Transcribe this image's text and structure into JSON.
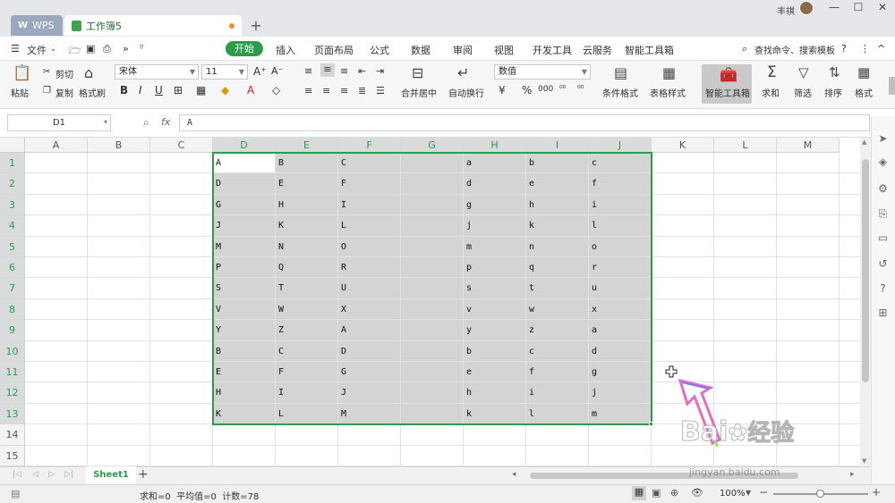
{
  "titlebar": {
    "tabs": [
      {
        "label": "WPS"
      },
      {
        "label": "工作簿5"
      }
    ],
    "add_tab": "+",
    "user_name": "丰祺",
    "window_controls": [
      "minimize-icon",
      "maximize-icon",
      "close-icon"
    ]
  },
  "menu": {
    "file": "文件",
    "start": "开始",
    "items": [
      "插入",
      "页面布局",
      "公式",
      "数据",
      "审阅",
      "视图",
      "开发工具",
      "云服务",
      "智能工具箱"
    ],
    "search": "查找命令、搜索模板"
  },
  "ribbon": {
    "paste": "粘贴",
    "cut": "剪切",
    "copy": "复制",
    "format_painter": "格式刷",
    "font_name": "宋体",
    "font_size": "11",
    "merge_center": "合并居中",
    "wrap_text": "自动换行",
    "number_format": "数值",
    "conditional_format": "条件格式",
    "table_style": "表格样式",
    "smart_toolbox": "智能工具箱",
    "sum": "求和",
    "filter": "筛选",
    "sort": "排序",
    "format": "格式",
    "percent": "%",
    "thousands": "000"
  },
  "formula_bar": {
    "name_box": "D1",
    "fx": "fx",
    "content": "A"
  },
  "sheet": {
    "columns": [
      "A",
      "B",
      "C",
      "D",
      "E",
      "F",
      "G",
      "H",
      "I",
      "J",
      "K",
      "L",
      "M"
    ],
    "rows": [
      "1",
      "2",
      "3",
      "4",
      "5",
      "6",
      "7",
      "8",
      "9",
      "10",
      "11",
      "12",
      "13",
      "14",
      "15"
    ],
    "data": [
      [
        "A",
        "B",
        "C",
        "",
        "a",
        "b",
        "c"
      ],
      [
        "D",
        "E",
        "F",
        "",
        "d",
        "e",
        "f"
      ],
      [
        "G",
        "H",
        "I",
        "",
        "g",
        "h",
        "i"
      ],
      [
        "J",
        "K",
        "L",
        "",
        "j",
        "k",
        "l"
      ],
      [
        "M",
        "N",
        "O",
        "",
        "m",
        "n",
        "o"
      ],
      [
        "P",
        "Q",
        "R",
        "",
        "p",
        "q",
        "r"
      ],
      [
        "S",
        "T",
        "U",
        "",
        "s",
        "t",
        "u"
      ],
      [
        "V",
        "W",
        "X",
        "",
        "v",
        "w",
        "x"
      ],
      [
        "Y",
        "Z",
        "A",
        "",
        "y",
        "z",
        "a"
      ],
      [
        "B",
        "C",
        "D",
        "",
        "b",
        "c",
        "d"
      ],
      [
        "E",
        "F",
        "G",
        "",
        "e",
        "f",
        "g"
      ],
      [
        "H",
        "I",
        "J",
        "",
        "h",
        "i",
        "j"
      ],
      [
        "K",
        "L",
        "M",
        "",
        "k",
        "l",
        "m"
      ]
    ],
    "tab": "Sheet1"
  },
  "statusbar": {
    "summary": "求和=0  平均值=0  计数=78",
    "zoom": "100%",
    "zoom_level": 0.5
  },
  "watermark": {
    "brand": "Bai",
    "brand2": "经验",
    "url": "jingyan.baidu.com"
  },
  "colors": {
    "accent_green": "#2c9b4a",
    "selection_fill": "#d4d4d4"
  }
}
